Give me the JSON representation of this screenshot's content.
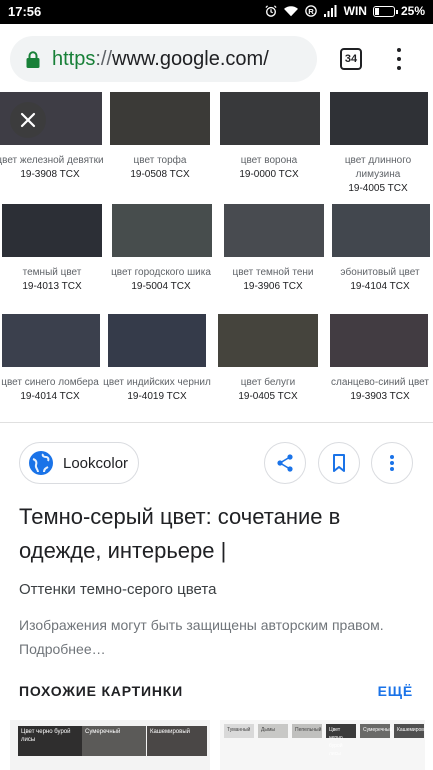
{
  "status_bar": {
    "time": "17:56",
    "carrier": "WIN",
    "battery": "25%",
    "battery_level": 0.25,
    "icons": [
      "alarm-icon",
      "wifi-icon",
      "registered-icon",
      "signal-icon",
      "battery-icon"
    ]
  },
  "browser": {
    "url_scheme": "https",
    "url_sep": "://",
    "url_host": "www.google.com/",
    "tab_count": "34",
    "accent": "#188038"
  },
  "swatches": [
    {
      "name": "цвет железной девятки",
      "code": "19-3908 TCX",
      "color": "#3e3d45"
    },
    {
      "name": "цвет торфа",
      "code": "19-0508 TCX",
      "color": "#3b3a37"
    },
    {
      "name": "цвет ворона",
      "code": "19-0000 TCX",
      "color": "#38393b"
    },
    {
      "name": "цвет длинного лимузина",
      "code": "19-4005 TCX",
      "color": "#2f3136"
    },
    {
      "name": "темный цвет",
      "code": "19-4013 TCX",
      "color": "#2c2f36"
    },
    {
      "name": "цвет городского шика",
      "code": "19-5004 TCX",
      "color": "#474d4d"
    },
    {
      "name": "цвет темной тени",
      "code": "19-3906 TCX",
      "color": "#484b50"
    },
    {
      "name": "эбонитовый цвет",
      "code": "19-4104 TCX",
      "color": "#42474e"
    },
    {
      "name": "цвет синего ломбера",
      "code": "19-4014 TCX",
      "color": "#3b404d"
    },
    {
      "name": "цвет индийских чернил",
      "code": "19-4019 TCX",
      "color": "#353b4a"
    },
    {
      "name": "цвет белуги",
      "code": "19-0405 TCX",
      "color": "#45443d"
    },
    {
      "name": "сланцево-синий цвет",
      "code": "19-3903 TCX",
      "color": "#423c42"
    }
  ],
  "source": {
    "name": "Lookcolor"
  },
  "title": "Темно-серый цвет: сочетание в одежде, интерьере |",
  "subtitle": "Оттенки темно-серого цвета",
  "notice": "Изображения могут быть защищены авторским правом. Подробнее…",
  "similar": {
    "heading": "ПОХОЖИЕ КАРТИНКИ",
    "more": "ЕЩЁ",
    "thumb1": [
      "Цвет черно бурой лисы",
      "Сумеречный",
      "Кашемировый"
    ],
    "thumb2": [
      "Туманный",
      "Дымы",
      "Пепельный",
      "Цвет черно бурой лисы",
      "Сумеречный",
      "Кашемировый"
    ]
  }
}
